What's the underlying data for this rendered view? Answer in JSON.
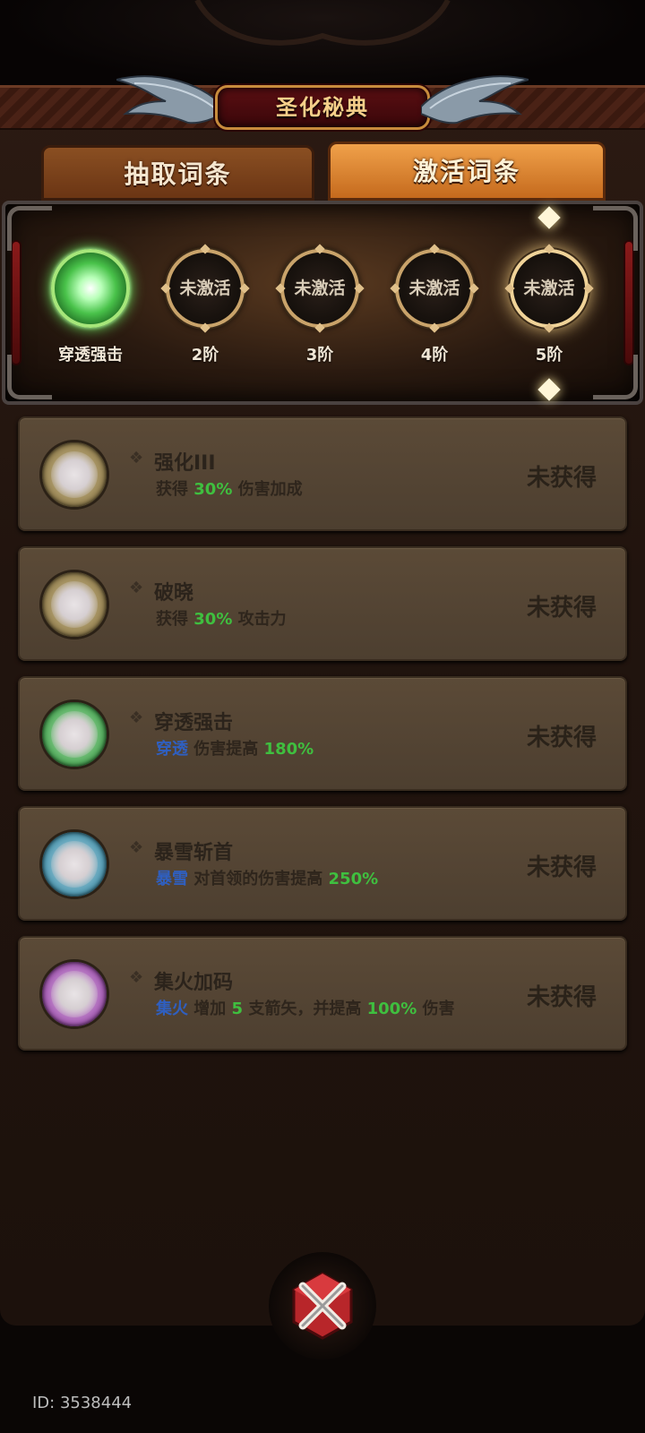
{
  "header": {
    "title": "圣化秘典"
  },
  "tabs": [
    {
      "label": "抽取词条",
      "active": false
    },
    {
      "label": "激活词条",
      "active": true
    }
  ],
  "tiers": [
    {
      "orb_text": "",
      "label": "穿透强击",
      "state": "active"
    },
    {
      "orb_text": "未激活",
      "label": "2阶",
      "state": "inactive"
    },
    {
      "orb_text": "未激活",
      "label": "3阶",
      "state": "inactive"
    },
    {
      "orb_text": "未激活",
      "label": "4阶",
      "state": "inactive"
    },
    {
      "orb_text": "未激活",
      "label": "5阶",
      "state": "highlight"
    }
  ],
  "entries": [
    {
      "name": "强化III",
      "desc": [
        {
          "t": "获得 ",
          "c": ""
        },
        {
          "t": "30%",
          "c": "green"
        },
        {
          "t": " 伤害加成",
          "c": ""
        }
      ],
      "status": "未获得",
      "orb_color": "#c9b57a"
    },
    {
      "name": "破晓",
      "desc": [
        {
          "t": "获得 ",
          "c": ""
        },
        {
          "t": "30%",
          "c": "green"
        },
        {
          "t": " 攻击力",
          "c": ""
        }
      ],
      "status": "未获得",
      "orb_color": "#c9b57a"
    },
    {
      "name": "穿透强击",
      "desc": [
        {
          "t": "穿透",
          "c": "blue"
        },
        {
          "t": " 伤害提高 ",
          "c": ""
        },
        {
          "t": "180%",
          "c": "green"
        }
      ],
      "status": "未获得",
      "orb_color": "#5fd25f"
    },
    {
      "name": "暴雪斩首",
      "desc": [
        {
          "t": "暴雪",
          "c": "blue"
        },
        {
          "t": " 对首领的伤害提高 ",
          "c": ""
        },
        {
          "t": "250%",
          "c": "green"
        }
      ],
      "status": "未获得",
      "orb_color": "#4fa9c9"
    },
    {
      "name": "集火加码",
      "desc": [
        {
          "t": "集火",
          "c": "blue"
        },
        {
          "t": " 增加 ",
          "c": ""
        },
        {
          "t": "5",
          "c": "green"
        },
        {
          "t": " 支箭矢，并提高 ",
          "c": ""
        },
        {
          "t": "100%",
          "c": "green"
        },
        {
          "t": " 伤害",
          "c": ""
        }
      ],
      "status": "未获得",
      "orb_color": "#b45fc9"
    }
  ],
  "footer": {
    "id_text": "ID: 3538444"
  },
  "colors": {
    "accent": "#f0a14a",
    "highlight_green": "#3fbf3f",
    "highlight_blue": "#2f5fc0"
  },
  "icons": {
    "close": "close-x-icon",
    "wing": "wing-icon",
    "tier_orb": "tier-orb-icon"
  }
}
